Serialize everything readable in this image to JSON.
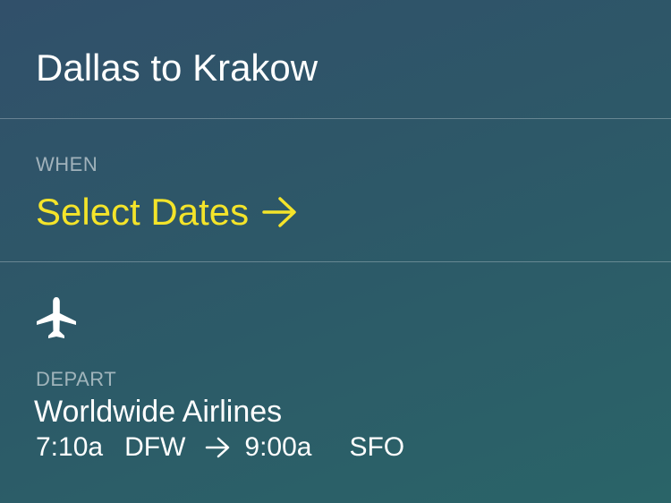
{
  "header": {
    "title": "Dallas to Krakow"
  },
  "when": {
    "label": "WHEN",
    "select_label": "Select Dates",
    "arrow_icon": "arrow-right-icon"
  },
  "flight": {
    "icon": "airplane-icon",
    "depart_label": "DEPART",
    "airline": "Worldwide Airlines",
    "depart_time": "7:10a",
    "depart_airport": "DFW",
    "arrive_time": "9:00a",
    "arrive_airport": "SFO"
  },
  "colors": {
    "accent": "#f4e42a",
    "background_top": "#31506a",
    "background_bottom": "#2a6468",
    "text": "#ffffff"
  }
}
